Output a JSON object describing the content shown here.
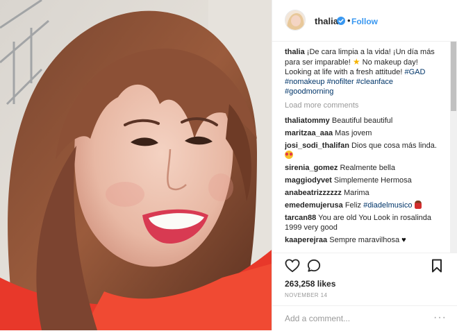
{
  "post": {
    "username": "thalia",
    "follow_label": "Follow",
    "dot": "•",
    "caption": {
      "username": "thalia",
      "text_1": "¡De cara limpia a la vida! ¡Un día más para ser imparable!",
      "text_2": "No makeup day! Looking at life with a fresh attitude!",
      "hashtags": [
        "#GAD",
        "#nomakeup",
        "#nofilter",
        "#cleanface",
        "#goodmorning"
      ]
    },
    "load_more_label": "Load more comments",
    "comments": [
      {
        "user": "thaliatommy",
        "text": "Beautiful beautiful"
      },
      {
        "user": "maritzaa_aaa",
        "text": "Mas jovem"
      },
      {
        "user": "josi_sodi_thalifan",
        "text": "Dios que cosa más linda."
      },
      {
        "user": "sirenia_gomez",
        "text": "Realmente bella"
      },
      {
        "user": "maggiodyvet",
        "text": "Simplemente Hermosa"
      },
      {
        "user": "anabeatrizzzzzz",
        "text": "Marima"
      },
      {
        "user": "emedemujerusa",
        "text": "Feliz",
        "hashtag": "#diadelmusico"
      },
      {
        "user": "tarcan88",
        "text": "You are old You Look in rosalinda 1999 very good"
      },
      {
        "user": "kaaperejraa",
        "text": "Sempre maravilhosa"
      }
    ],
    "likes": "263,258 likes",
    "date": "NOVEMBER 14",
    "add_comment_placeholder": "Add a comment...",
    "more_label": "···"
  },
  "icons": {
    "like": "heart-outline-icon",
    "comment": "comment-bubble-icon",
    "save": "bookmark-icon",
    "verified": "verified-badge-icon"
  },
  "colors": {
    "link_blue": "#3897f0",
    "hashtag": "#003569",
    "muted": "#999999",
    "text": "#262626"
  }
}
